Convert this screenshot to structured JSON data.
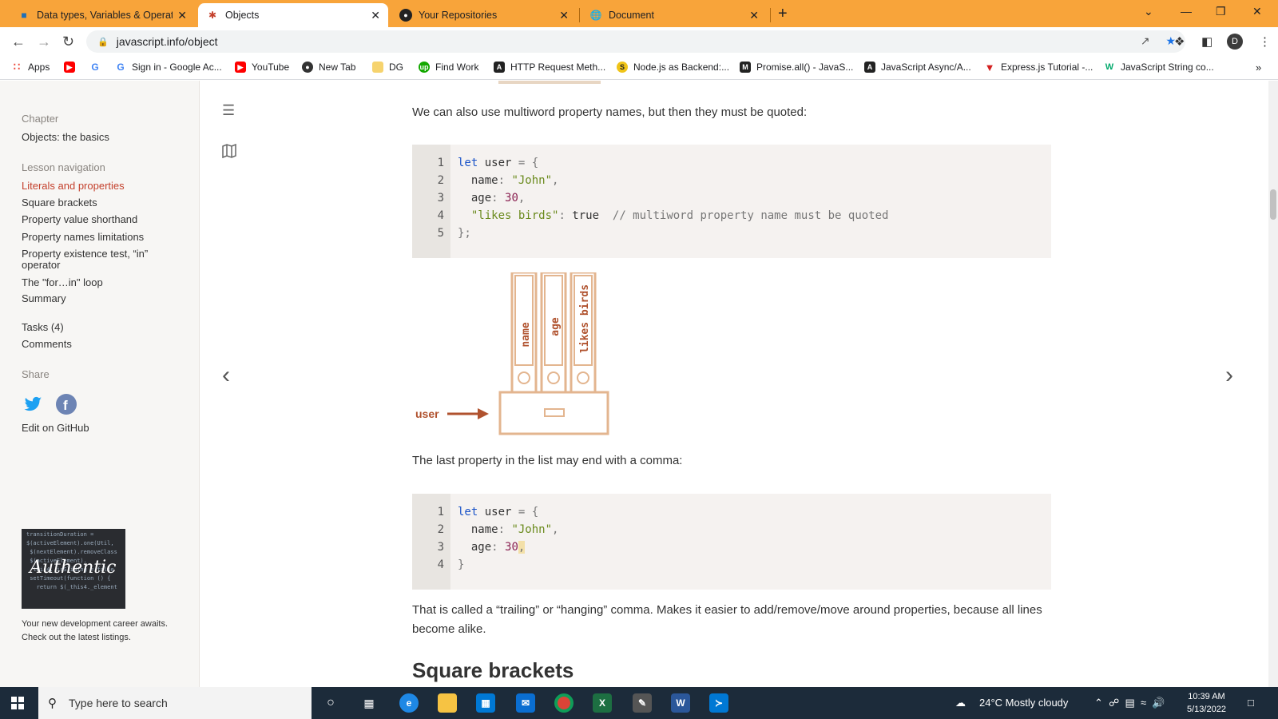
{
  "browser": {
    "tabs": [
      {
        "title": "Data types, Variables & Operator",
        "icon": "vscode-folder-icon"
      },
      {
        "title": "Objects",
        "icon": "javascript-info-icon"
      },
      {
        "title": "Your Repositories",
        "icon": "github-icon"
      },
      {
        "title": "Document",
        "icon": "globe-icon"
      }
    ],
    "url": "javascript.info/object",
    "profile_initial": "D",
    "bookmarks": [
      {
        "label": "Apps",
        "icon": "apps-grid-icon",
        "color": "#ea4335"
      },
      {
        "label": "",
        "icon": "youtube-icon",
        "color": "#ff0000"
      },
      {
        "label": "",
        "icon": "google-icon",
        "color": "#4285f4"
      },
      {
        "label": "Sign in - Google Ac...",
        "icon": "google-icon",
        "color": "#4285f4"
      },
      {
        "label": "YouTube",
        "icon": "youtube-icon",
        "color": "#ff0000"
      },
      {
        "label": "New Tab",
        "icon": "globe-icon",
        "color": "#333333"
      },
      {
        "label": "DG",
        "icon": "folder-icon",
        "color": "#f6c343"
      },
      {
        "label": "Find Work",
        "icon": "upwork-icon",
        "color": "#14a800"
      },
      {
        "label": "HTTP Request Meth...",
        "icon": "javascript-info-icon",
        "color": "#222222"
      },
      {
        "label": "Node.js as Backend:...",
        "icon": "dollar-icon",
        "color": "#f0c419"
      },
      {
        "label": "Promise.all() - JavaS...",
        "icon": "mdn-icon",
        "color": "#222222"
      },
      {
        "label": "JavaScript Async/A...",
        "icon": "javascript-info-icon",
        "color": "#222222"
      },
      {
        "label": "Express.js Tutorial -...",
        "icon": "tutorial-icon",
        "color": "#d42020"
      },
      {
        "label": "JavaScript String co...",
        "icon": "w3-icon",
        "color": "#04aa6d"
      }
    ]
  },
  "sidebar": {
    "chapter_label": "Chapter",
    "chapter_title": "Objects: the basics",
    "lesson_nav_label": "Lesson navigation",
    "items": [
      "Literals and properties",
      "Square brackets",
      "Property value shorthand",
      "Property names limitations",
      "Property existence test, “in” operator",
      "The \"for…in\" loop",
      "Summary"
    ],
    "tasks": "Tasks (4)",
    "comments": "Comments",
    "share_label": "Share",
    "edit_github": "Edit on GitHub",
    "ad_brand": "Authentic",
    "ad_text": "Your new development career awaits. Check out the latest listings."
  },
  "content": {
    "para1": "We can also use multiword property names, but then they must be quoted:",
    "code1": [
      {
        "n": "1",
        "text": "let user = {"
      },
      {
        "n": "2",
        "text": "  name: \"John\","
      },
      {
        "n": "3",
        "text": "  age: 30,"
      },
      {
        "n": "4",
        "text": "  \"likes birds\": true  // multiword property name must be quoted"
      },
      {
        "n": "5",
        "text": "};"
      }
    ],
    "figure": {
      "binders": [
        "name",
        "age",
        "likes birds"
      ],
      "arrow_label": "user"
    },
    "para2": "The last property in the list may end with a comma:",
    "code2": [
      {
        "n": "1",
        "text": "let user = {"
      },
      {
        "n": "2",
        "text": "  name: \"John\","
      },
      {
        "n": "3",
        "text": "  age: 30,"
      },
      {
        "n": "4",
        "text": "}"
      }
    ],
    "para3": "That is called a “trailing” or “hanging” comma. Makes it easier to add/remove/move around properties, because all lines become alike.",
    "next_heading": "Square brackets"
  },
  "taskbar": {
    "search_placeholder": "Type here to search",
    "weather": "24°C  Mostly cloudy",
    "time": "10:39 AM",
    "date": "5/13/2022"
  }
}
